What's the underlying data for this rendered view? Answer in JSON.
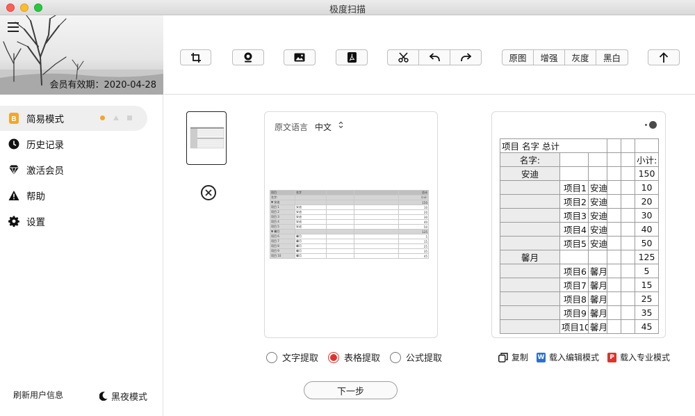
{
  "window": {
    "title": "极度扫描"
  },
  "sidebar": {
    "member_expiry": "会员有效期：2020-04-28",
    "items": [
      {
        "label": "简易模式",
        "icon": "b-badge-icon"
      },
      {
        "label": "历史记录",
        "icon": "clock-icon"
      },
      {
        "label": "激活会员",
        "icon": "diamond-icon"
      },
      {
        "label": "帮助",
        "icon": "warning-icon"
      },
      {
        "label": "设置",
        "icon": "gear-icon"
      }
    ],
    "refresh_user": "刷新用户信息",
    "night_mode": "黑夜模式"
  },
  "toolbar": {
    "filters": [
      "原图",
      "增强",
      "灰度",
      "黑白"
    ],
    "icons": [
      "crop-icon",
      "camera-icon",
      "image-icon",
      "pdf-icon",
      "scissors-icon",
      "undo-icon",
      "redo-icon",
      "upload-icon"
    ]
  },
  "source": {
    "lang_label": "原文语言",
    "lang_value": "中文",
    "mini_table": {
      "header": [
        "项目",
        "名字",
        "",
        "",
        "总计"
      ],
      "rows": [
        [
          "名字:",
          "",
          "",
          "",
          "小计:"
        ],
        [
          "▼ 安迪",
          "",
          "",
          "",
          "150"
        ],
        [
          "项目 1",
          "安迪",
          "",
          "",
          "10"
        ],
        [
          "项目 2",
          "安迪",
          "",
          "",
          "20"
        ],
        [
          "项目 3",
          "安迪",
          "",
          "",
          "30"
        ],
        [
          "项目 4",
          "安迪",
          "",
          "",
          "40"
        ],
        [
          "项目 5",
          "安迪",
          "",
          "",
          "50"
        ],
        [
          "▼ 馨月",
          "",
          "",
          "",
          "125"
        ],
        [
          "项目 6",
          "馨月",
          "",
          "",
          "5"
        ],
        [
          "项目 7",
          "馨月",
          "",
          "",
          "15"
        ],
        [
          "项目 8",
          "馨月",
          "",
          "",
          "25"
        ],
        [
          "项目 9",
          "馨月",
          "",
          "",
          "35"
        ],
        [
          "项目 10",
          "馨月",
          "",
          "",
          "45"
        ]
      ]
    }
  },
  "result": {
    "title_cell": "项目 名字 总计",
    "name_label": "名字:",
    "subtotal_label": "小计:",
    "groups": [
      {
        "name": "安迪",
        "total": "150",
        "items": [
          [
            "项目1",
            "安迪",
            "10"
          ],
          [
            "项目2",
            "安迪",
            "20"
          ],
          [
            "项目3",
            "安迪",
            "30"
          ],
          [
            "项目4",
            "安迪",
            "40"
          ],
          [
            "项目5",
            "安迪",
            "50"
          ]
        ]
      },
      {
        "name": "馨月",
        "total": "125",
        "items": [
          [
            "项目6",
            "馨月",
            "5"
          ],
          [
            "项目7",
            "馨月",
            "15"
          ],
          [
            "项目8",
            "馨月",
            "25"
          ],
          [
            "项目9",
            "馨月",
            "35"
          ],
          [
            "项目10",
            "馨月",
            "45"
          ]
        ]
      }
    ]
  },
  "modes": {
    "text": "文字提取",
    "table": "表格提取",
    "formula": "公式提取",
    "selected": "表格提取"
  },
  "actions": {
    "copy": "复制",
    "edit": "载入编辑模式",
    "pro": "载入专业模式"
  },
  "next": "下一步",
  "colors": {
    "accent": "#e0322c",
    "word_blue": "#2b6fd6",
    "pdf_red": "#e0322c",
    "dot_orange": "#f5a623"
  }
}
